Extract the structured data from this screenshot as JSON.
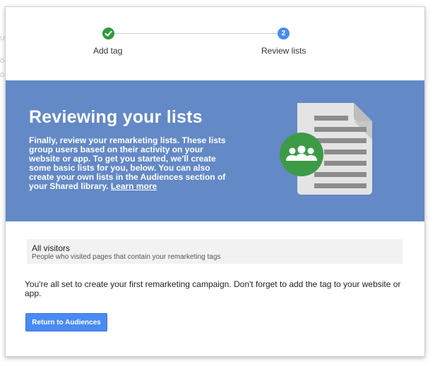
{
  "steps": [
    {
      "label": "Add tag",
      "status": "done",
      "icon": "check-icon"
    },
    {
      "label": "Review lists",
      "status": "current",
      "number": "2"
    }
  ],
  "banner": {
    "title": "Reviewing your lists",
    "text_part1": "Finally, review your remarketing lists. These lists group users based on their activity on your website or app. To get you started, we'll create some basic lists for you, below. You can also create your own lists in the ",
    "bold1": "Audiences",
    "text_part2": " section of your ",
    "bold2": "Shared library",
    "text_part3": ". ",
    "link": "Learn more",
    "illustration_icon": "document-audience-icon"
  },
  "list": {
    "name": "All visitors",
    "description": "People who visited pages that contain your remarketing tags"
  },
  "message": "You're all set to create your first remarketing campaign. Don't forget to add the tag to your website or app.",
  "button": {
    "label": "Return to Audiences"
  },
  "colors": {
    "banner_bg": "#6389c6",
    "step_done": "#2e9a3b",
    "step_current": "#4a8cf0",
    "button_bg": "#4a8af4",
    "audience_circle": "#3d9a46"
  }
}
